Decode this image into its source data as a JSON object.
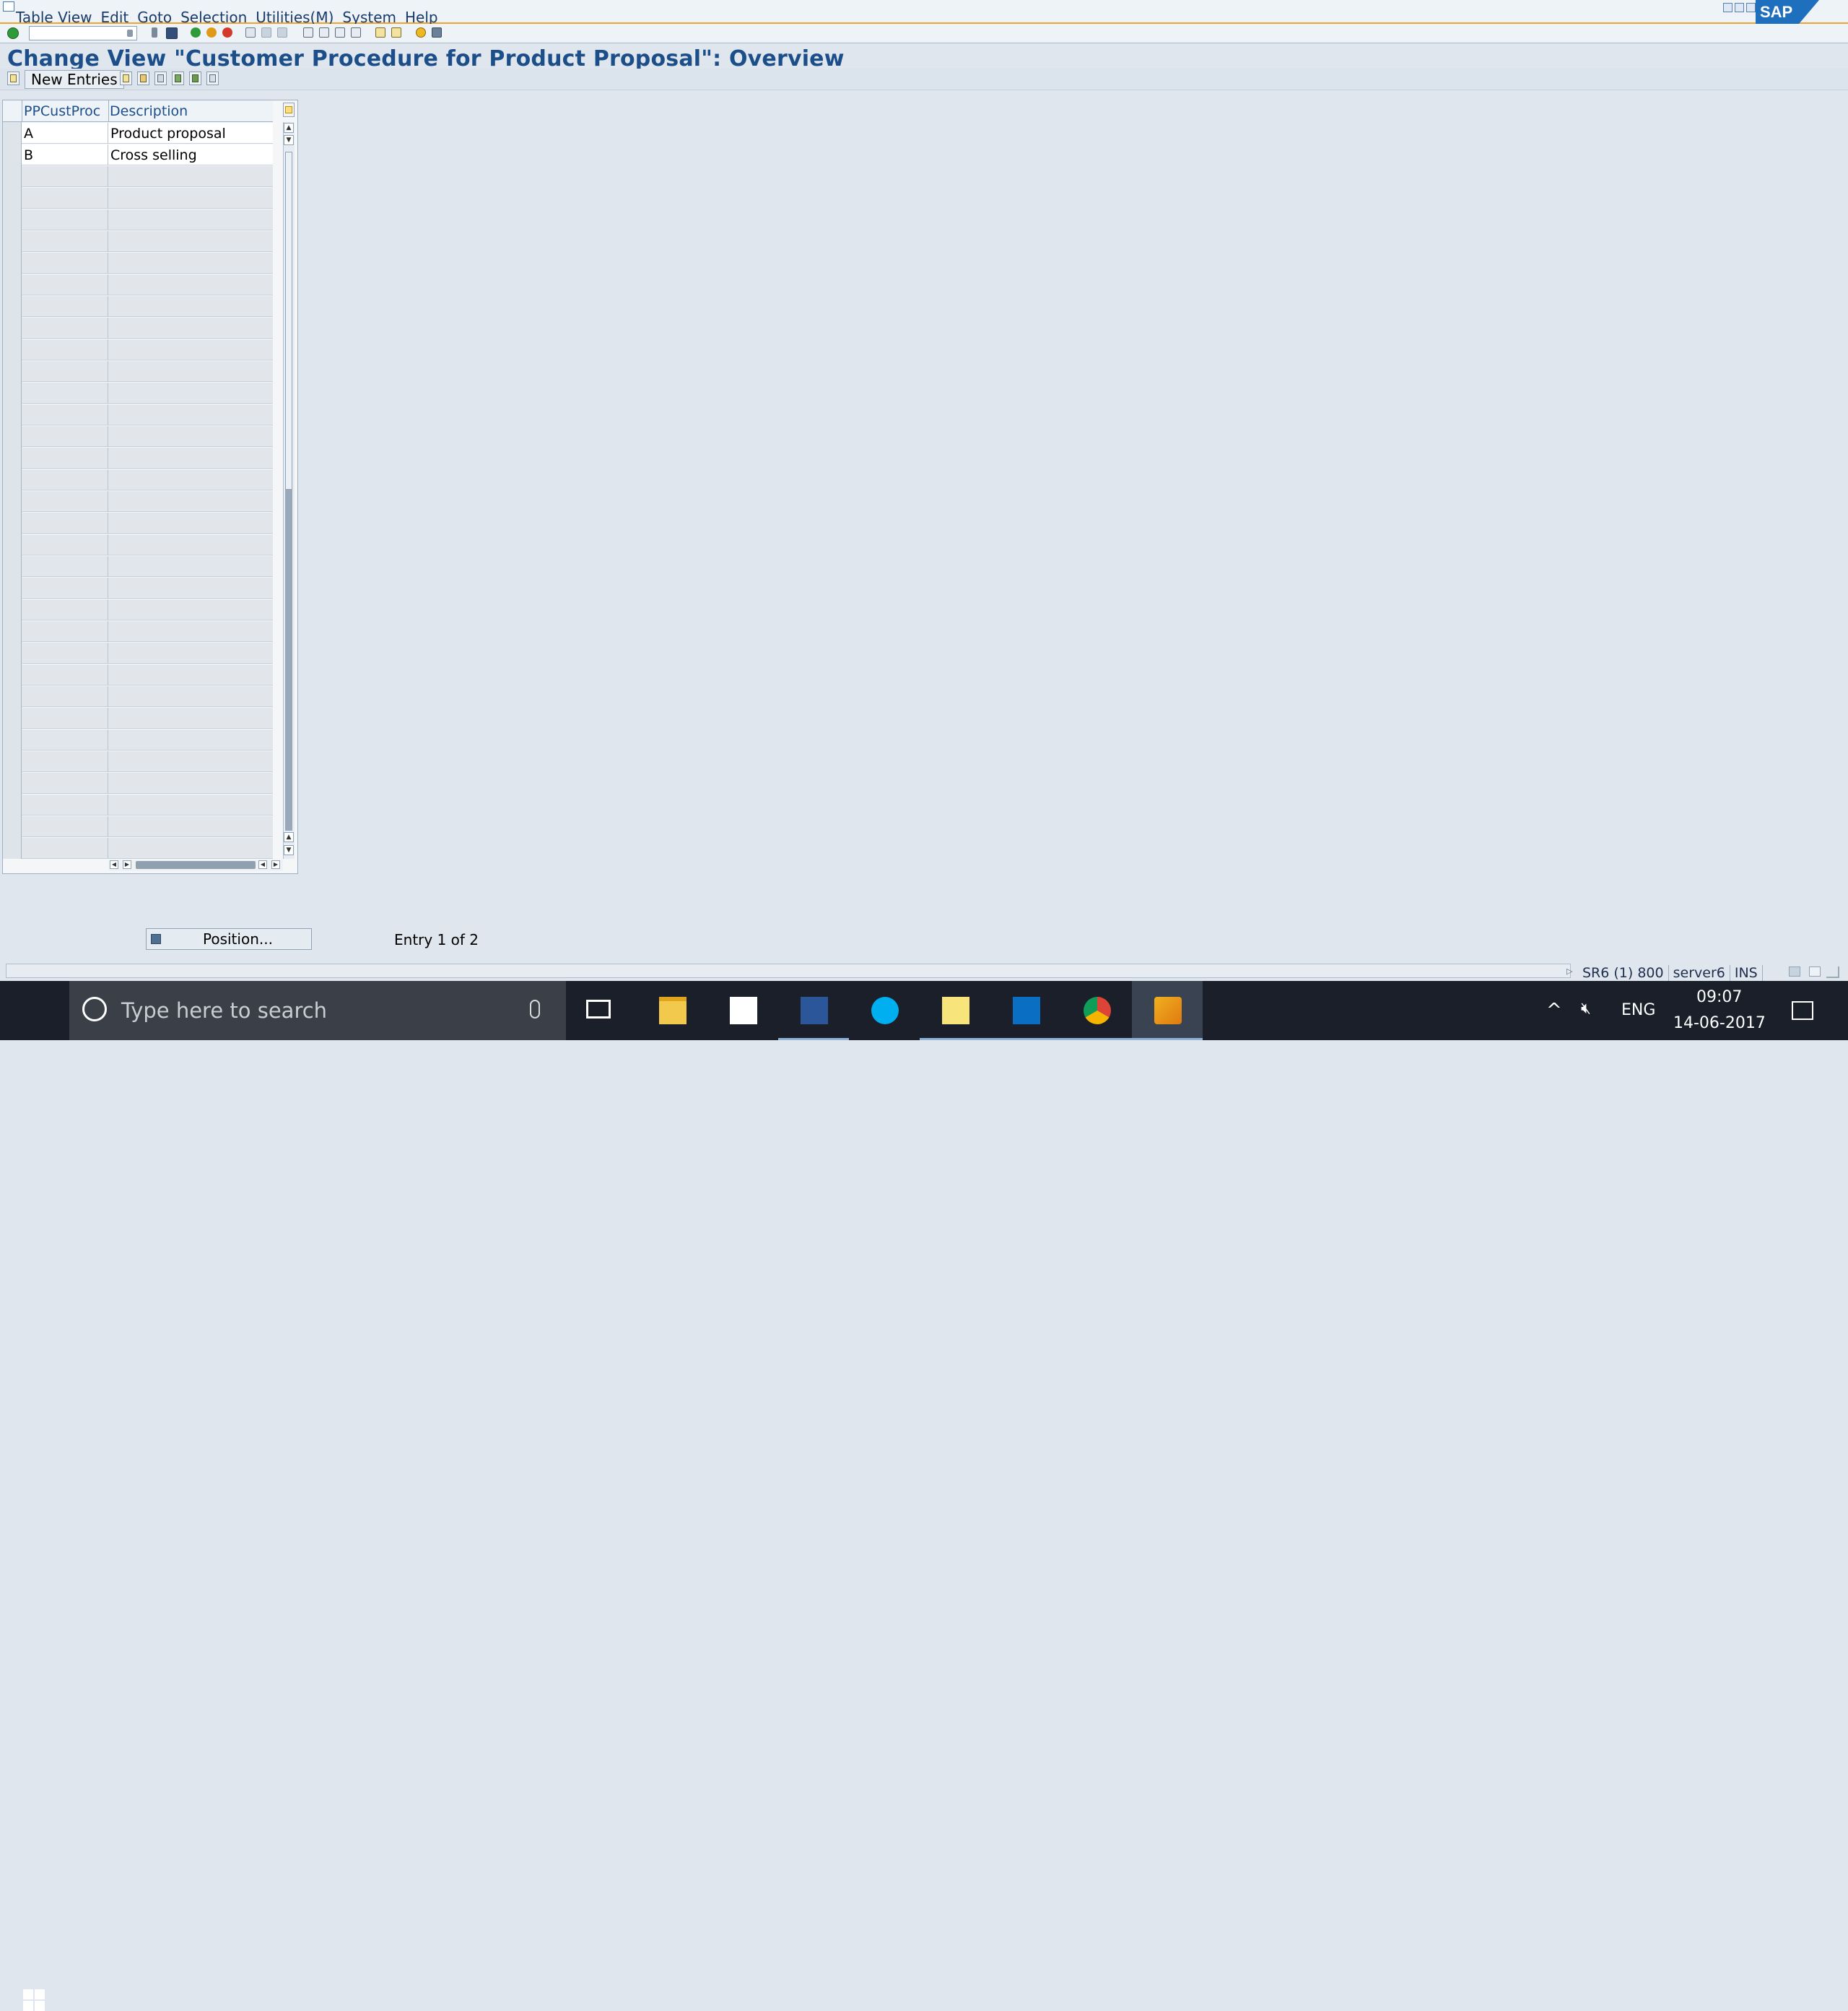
{
  "menu": {
    "items": [
      "Table View",
      "Edit",
      "Goto",
      "Selection",
      "Utilities(M)",
      "System",
      "Help"
    ]
  },
  "logo": "SAP",
  "title": "Change View \"Customer Procedure for Product Proposal\": Overview",
  "toolbar": {
    "new_entries_label": "New Entries"
  },
  "table": {
    "columns": [
      "PPCustProc",
      "Description"
    ],
    "rows": [
      {
        "code": "A",
        "description": "Product proposal"
      },
      {
        "code": "B",
        "description": "Cross selling"
      }
    ]
  },
  "position_button": {
    "label": "Position..."
  },
  "entry_info": "Entry 1 of 2",
  "status": {
    "system": "SR6 (1) 800",
    "server": "server6",
    "mode": "INS"
  },
  "taskbar": {
    "search_placeholder": "Type here to search",
    "language": "ENG",
    "time": "09:07",
    "date": "14-06-2017",
    "apps": [
      "task-view-icon",
      "file-explorer-icon",
      "store-icon",
      "word-icon",
      "skype-icon",
      "sticky-notes-icon",
      "outlook-icon",
      "chrome-icon",
      "sap-logon-icon"
    ]
  },
  "colors": {
    "title": "#1c4e8a",
    "accent": "#f0a430",
    "taskbar": "#1a1f2a"
  }
}
